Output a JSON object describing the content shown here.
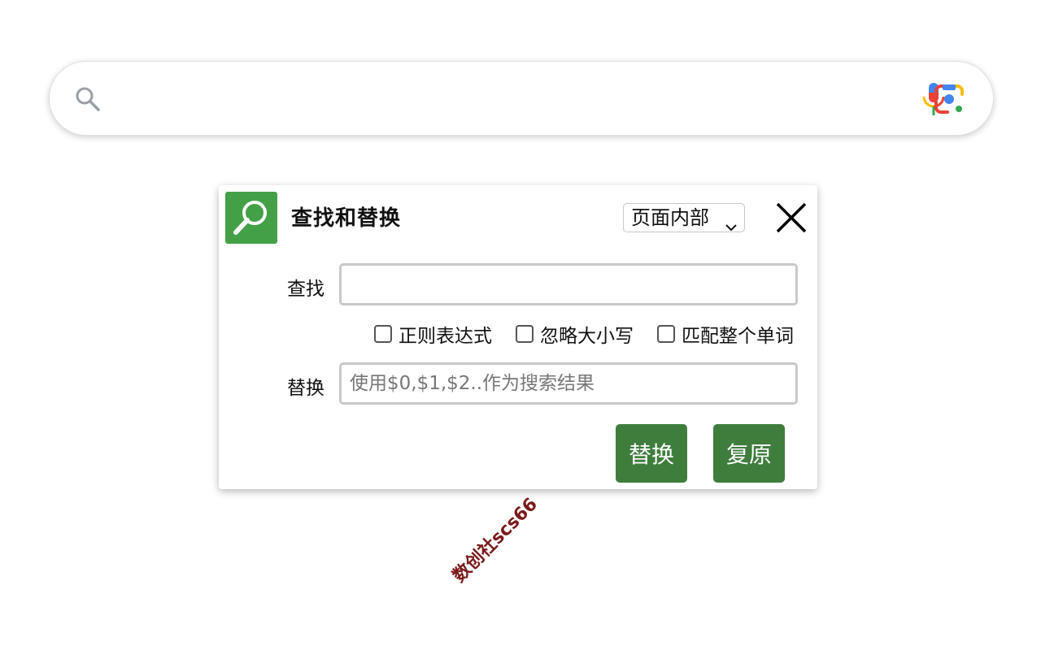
{
  "search_bar": {
    "placeholder": "",
    "icons": [
      "search-icon",
      "microphone-icon",
      "camera-lens-icon"
    ]
  },
  "dialog": {
    "icon": "magnifier-icon",
    "title": "查找和替换",
    "scope_select": {
      "selected": "页面内部"
    },
    "close_icon": "close-icon",
    "find": {
      "label": "查找",
      "value": ""
    },
    "options": [
      {
        "label": "正则表达式",
        "checked": false
      },
      {
        "label": "忽略大小写",
        "checked": false
      },
      {
        "label": "匹配整个单词",
        "checked": false
      }
    ],
    "replace": {
      "label": "替换",
      "placeholder": "使用$0,$1,$2..作为搜索结果",
      "value": ""
    },
    "buttons": {
      "replace": "替换",
      "restore": "复原"
    }
  },
  "watermark": "数创社scs66",
  "colors": {
    "accent_green": "#43a047",
    "button_green": "#3f7d3d"
  }
}
